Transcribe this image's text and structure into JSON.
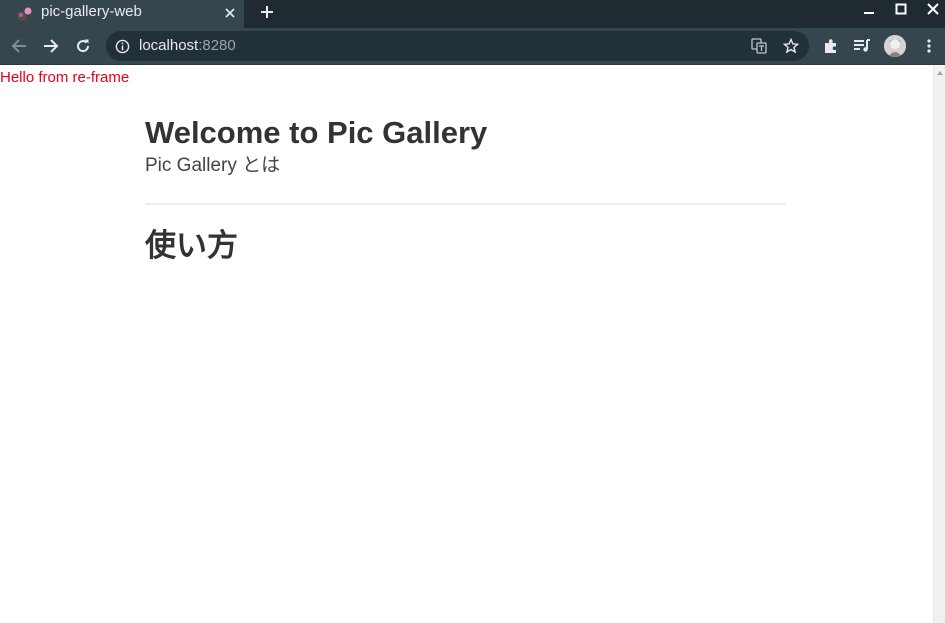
{
  "browser": {
    "tab_title": "pic-gallery-web",
    "url_host": "localhost",
    "url_port": ":8280",
    "icons": [
      "close-icon",
      "plus-icon",
      "minimize-icon",
      "maximize-icon",
      "back-icon",
      "forward-icon",
      "reload-icon",
      "info-icon",
      "translate-icon",
      "star-icon",
      "extensions-icon",
      "media-control-icon",
      "more-vert-icon"
    ]
  },
  "page": {
    "notice": "Hello from re-frame",
    "title": "Welcome to Pic Gallery",
    "subtitle": "Pic Gallery とは",
    "section_heading": "使い方"
  },
  "colors": {
    "notice": "#e8001c",
    "chrome_dark": "#1f2a31",
    "chrome_light": "#35464e"
  }
}
